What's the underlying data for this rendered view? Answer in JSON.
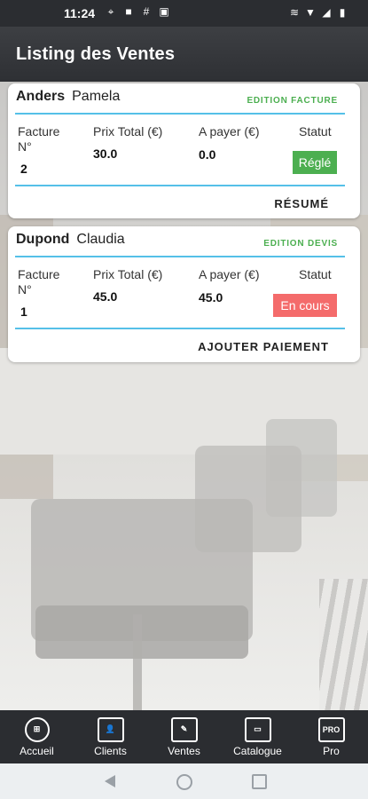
{
  "statusbar": {
    "time": "11:24",
    "left_icons": [
      "location-icon",
      "puzzle-icon",
      "grid-icon",
      "image-icon"
    ],
    "right_icons": [
      "vibrate-icon",
      "wifi-icon",
      "signal-icon",
      "battery-icon"
    ]
  },
  "appbar": {
    "title": "Listing des Ventes"
  },
  "columns": {
    "invoice": "Facture N°",
    "total": "Prix Total (€)",
    "to_pay": "A payer (€)",
    "status": "Statut"
  },
  "sales": [
    {
      "last_name": "Anders",
      "first_name": "Pamela",
      "edition": "EDITION FACTURE",
      "invoice_no": "2",
      "total": "30.0",
      "to_pay": "0.0",
      "status": "Réglé",
      "action": "RÉSUMÉ",
      "status_color": "#4caf50"
    },
    {
      "last_name": "Dupond",
      "first_name": "Claudia",
      "edition": "EDITION DEVIS",
      "invoice_no": "1",
      "total": "45.0",
      "to_pay": "45.0",
      "status": "En cours",
      "action": "AJOUTER PAIEMENT",
      "status_color": "#f46b6b"
    }
  ],
  "bottom_nav": [
    {
      "label": "Accueil",
      "icon": "home-grid-icon"
    },
    {
      "label": "Clients",
      "icon": "clients-folder-icon"
    },
    {
      "label": "Ventes",
      "icon": "sales-folder-icon"
    },
    {
      "label": "Catalogue",
      "icon": "catalogue-folder-icon"
    },
    {
      "label": "Pro",
      "icon": "pro-folder-icon",
      "icon_text": "PRO"
    }
  ],
  "colors": {
    "accent_line": "#55c0e8",
    "edition_green": "#4caf50"
  }
}
